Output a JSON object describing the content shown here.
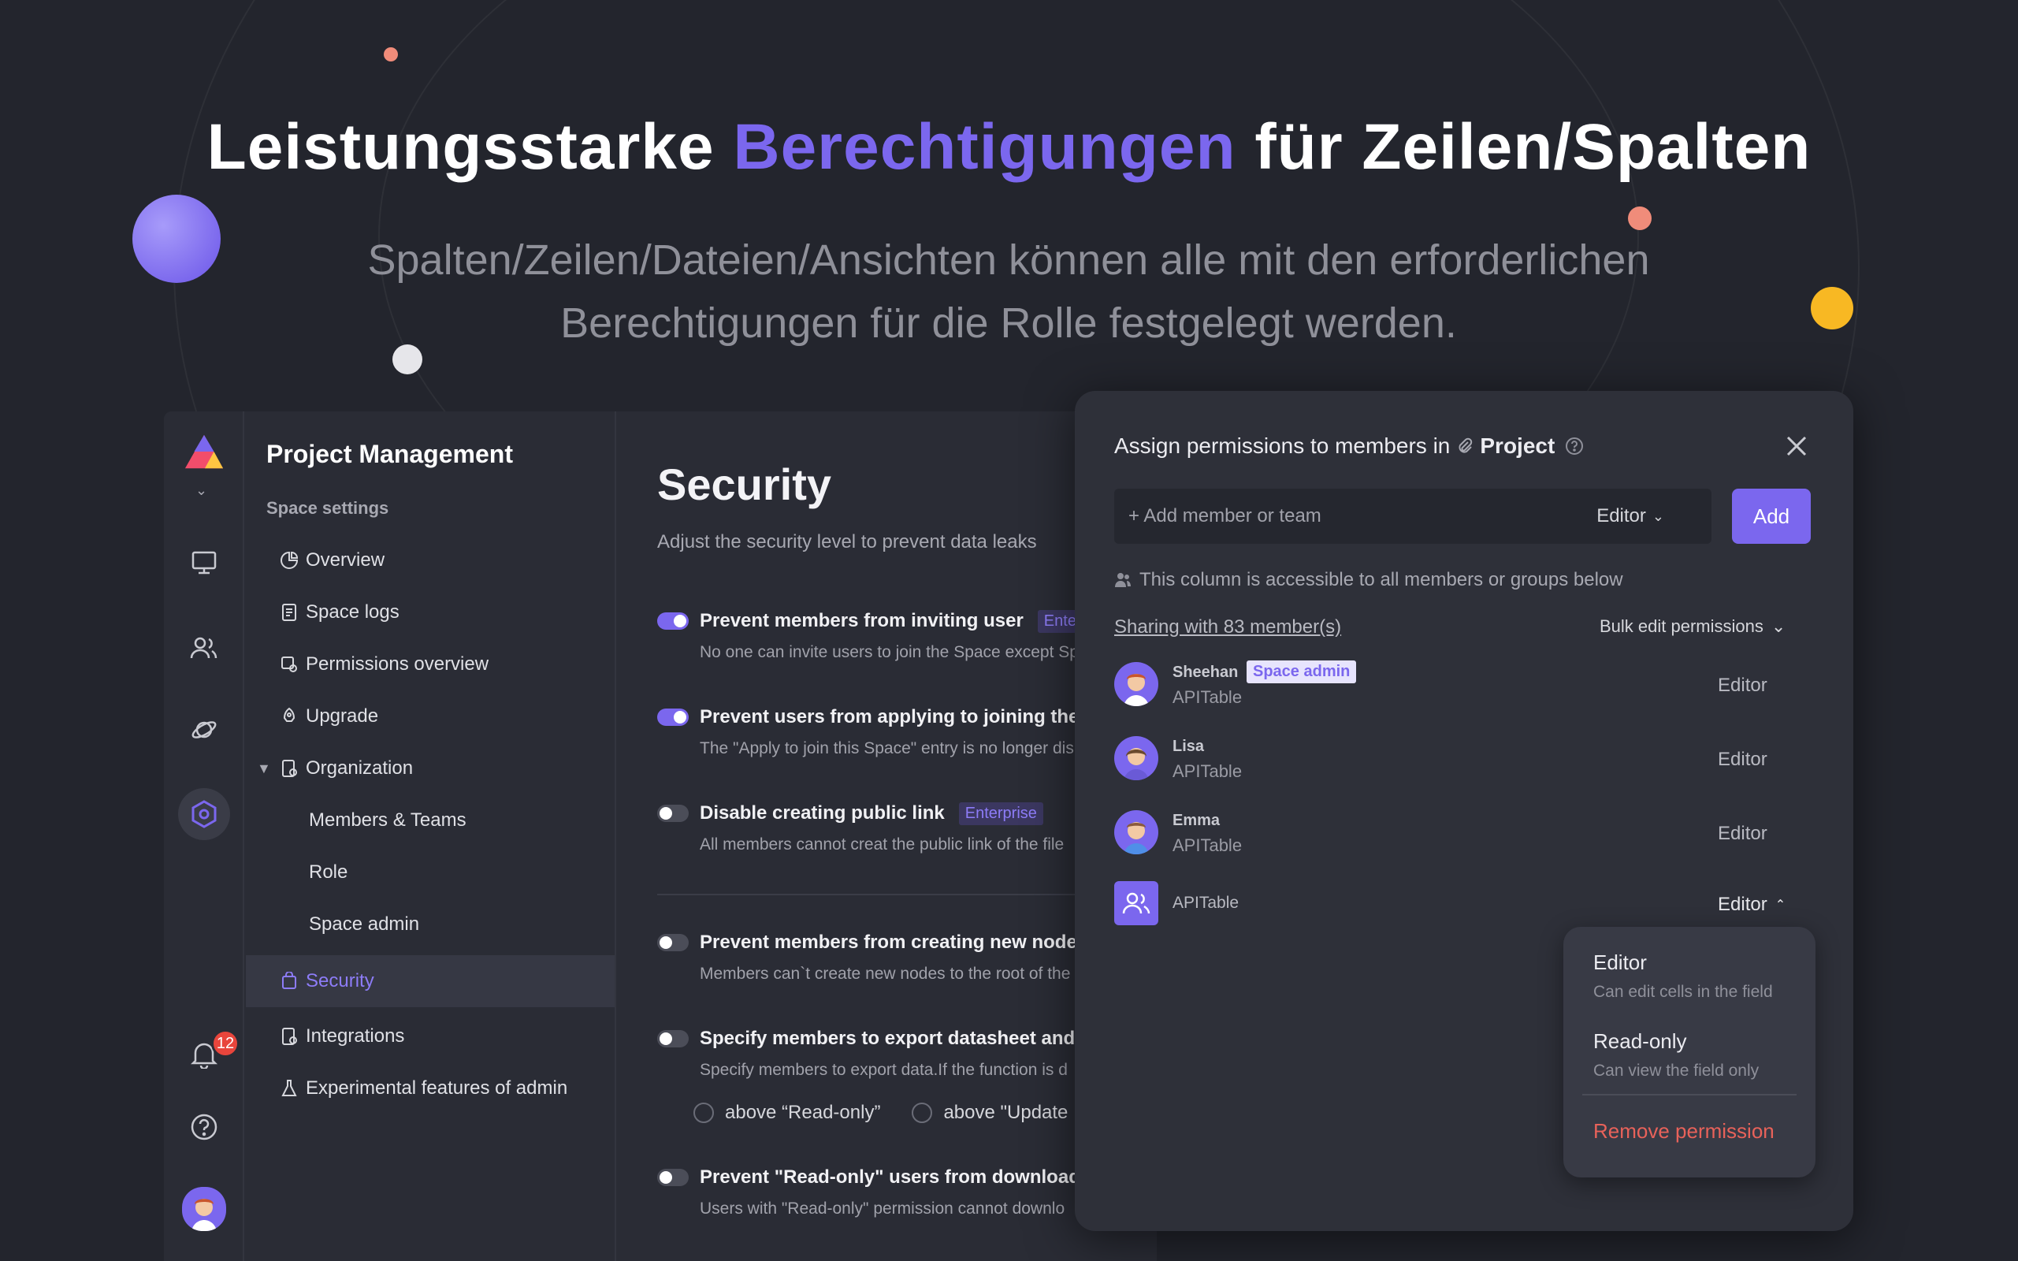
{
  "hero": {
    "title_pre": "Leistungsstarke ",
    "title_accent": "Berechtigungen",
    "title_post": " für Zeilen/Spalten",
    "subtitle_line1": "Spalten/Zeilen/Dateien/Ansichten können alle mit den erforderlichen",
    "subtitle_line2": "Berechtigungen für die Rolle festgelegt werden."
  },
  "colors": {
    "accent": "#7b67ee",
    "background": "#23252d",
    "danger": "#e8625a"
  },
  "rail": {
    "notification_count": "12"
  },
  "sidebar": {
    "title": "Project Management",
    "section": "Space settings",
    "items": [
      {
        "label": "Overview",
        "icon": "pie-chart-icon"
      },
      {
        "label": "Space logs",
        "icon": "log-icon"
      },
      {
        "label": "Permissions overview",
        "icon": "permissions-icon"
      },
      {
        "label": "Upgrade",
        "icon": "rocket-icon"
      },
      {
        "label": "Organization",
        "icon": "organization-icon"
      },
      {
        "label": "Members & Teams"
      },
      {
        "label": "Role"
      },
      {
        "label": "Space admin"
      },
      {
        "label": "Security",
        "icon": "shield-icon"
      },
      {
        "label": "Integrations",
        "icon": "integrations-icon"
      },
      {
        "label": "Experimental features of admin",
        "icon": "flask-icon"
      }
    ]
  },
  "main": {
    "title": "Security",
    "description": "Adjust the security level to prevent data leaks",
    "options": [
      {
        "label": "Prevent members from inviting user",
        "tag": "Enter",
        "sub": "No one can invite users to join the Space except Sp",
        "on": true
      },
      {
        "label": "Prevent users from applying to joining the S",
        "tag": "",
        "sub": "The \"Apply to join this Space\" entry is no longer dis",
        "on": true
      },
      {
        "label": "Disable creating public link",
        "tag": "Enterprise",
        "sub": "All members cannot creat the public link of the file",
        "on": false
      },
      {
        "label": "Prevent members from creating new nodes",
        "tag": "",
        "sub": "Members can`t create new nodes to the root of the",
        "on": false
      },
      {
        "label": "Specify members to export datasheet and v",
        "tag": "",
        "sub": "Specify members to export data.If the function is d",
        "on": false
      },
      {
        "label": "Prevent \"Read-only\" users from downloadir",
        "tag": "",
        "sub": "Users with \"Read-only\" permission cannot downlo",
        "on": false
      }
    ],
    "radio_a": "above “Read-only”",
    "radio_b": "above \"Update"
  },
  "modal": {
    "title": "Assign permissions to members in",
    "project": "Project",
    "input_placeholder": "+ Add member or team",
    "input_role": "Editor",
    "add_label": "Add",
    "note": "This column is accessible to all members or groups below",
    "share_link": "Sharing with 83 member(s)",
    "bulk_label": "Bulk edit permissions",
    "members": [
      {
        "name": "Sheehan",
        "badge": "Space admin",
        "org": "APITable",
        "perm": "Editor"
      },
      {
        "name": "Lisa",
        "badge": "",
        "org": "APITable",
        "perm": "Editor"
      },
      {
        "name": "Emma",
        "badge": "",
        "org": "APITable",
        "perm": "Editor"
      },
      {
        "name": "",
        "badge": "",
        "org": "APITable",
        "perm": "Editor"
      }
    ],
    "dropdown": {
      "editor_title": "Editor",
      "editor_desc": "Can edit cells in the field",
      "readonly_title": "Read-only",
      "readonly_desc": "Can view the field only",
      "remove": "Remove permission"
    }
  }
}
